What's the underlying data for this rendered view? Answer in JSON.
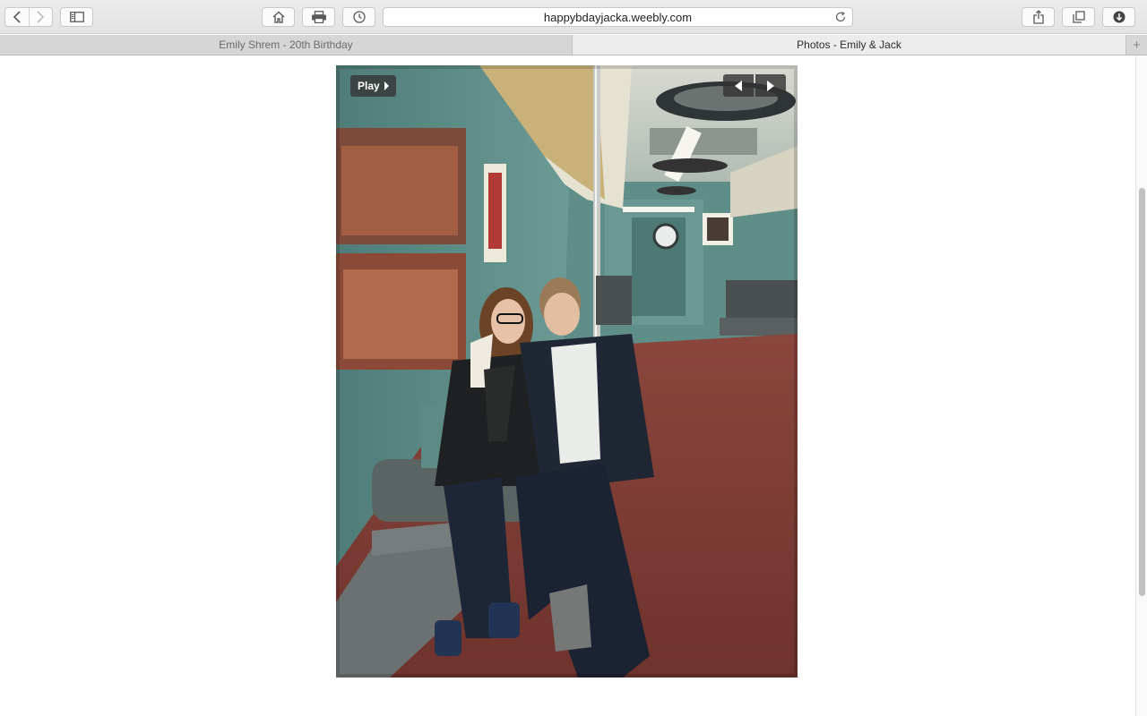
{
  "browser": {
    "address": "happybdayjacka.weebly.com",
    "tabs": [
      {
        "label": "Emily Shrem - 20th Birthday",
        "active": false
      },
      {
        "label": "Photos - Emily & Jack",
        "active": true
      }
    ],
    "new_tab_glyph": "+",
    "icons": {
      "back": "back-arrow-icon",
      "forward": "forward-arrow-icon",
      "sidebar": "sidebar-icon",
      "home": "home-icon",
      "print": "print-icon",
      "history": "history-icon",
      "reload": "reload-icon",
      "share": "share-icon",
      "tabs_overview": "tabs-overview-icon",
      "downloads": "downloads-icon"
    }
  },
  "slideshow": {
    "play_label": "Play",
    "photo_subject": "Two people sitting in a vintage teal subway car"
  },
  "colors": {
    "toolbar_bg": "#e6e6e6",
    "active_tab_bg": "#ececec",
    "photo_wall_teal": "#5f8b87",
    "photo_floor_red": "#7a3a32"
  }
}
